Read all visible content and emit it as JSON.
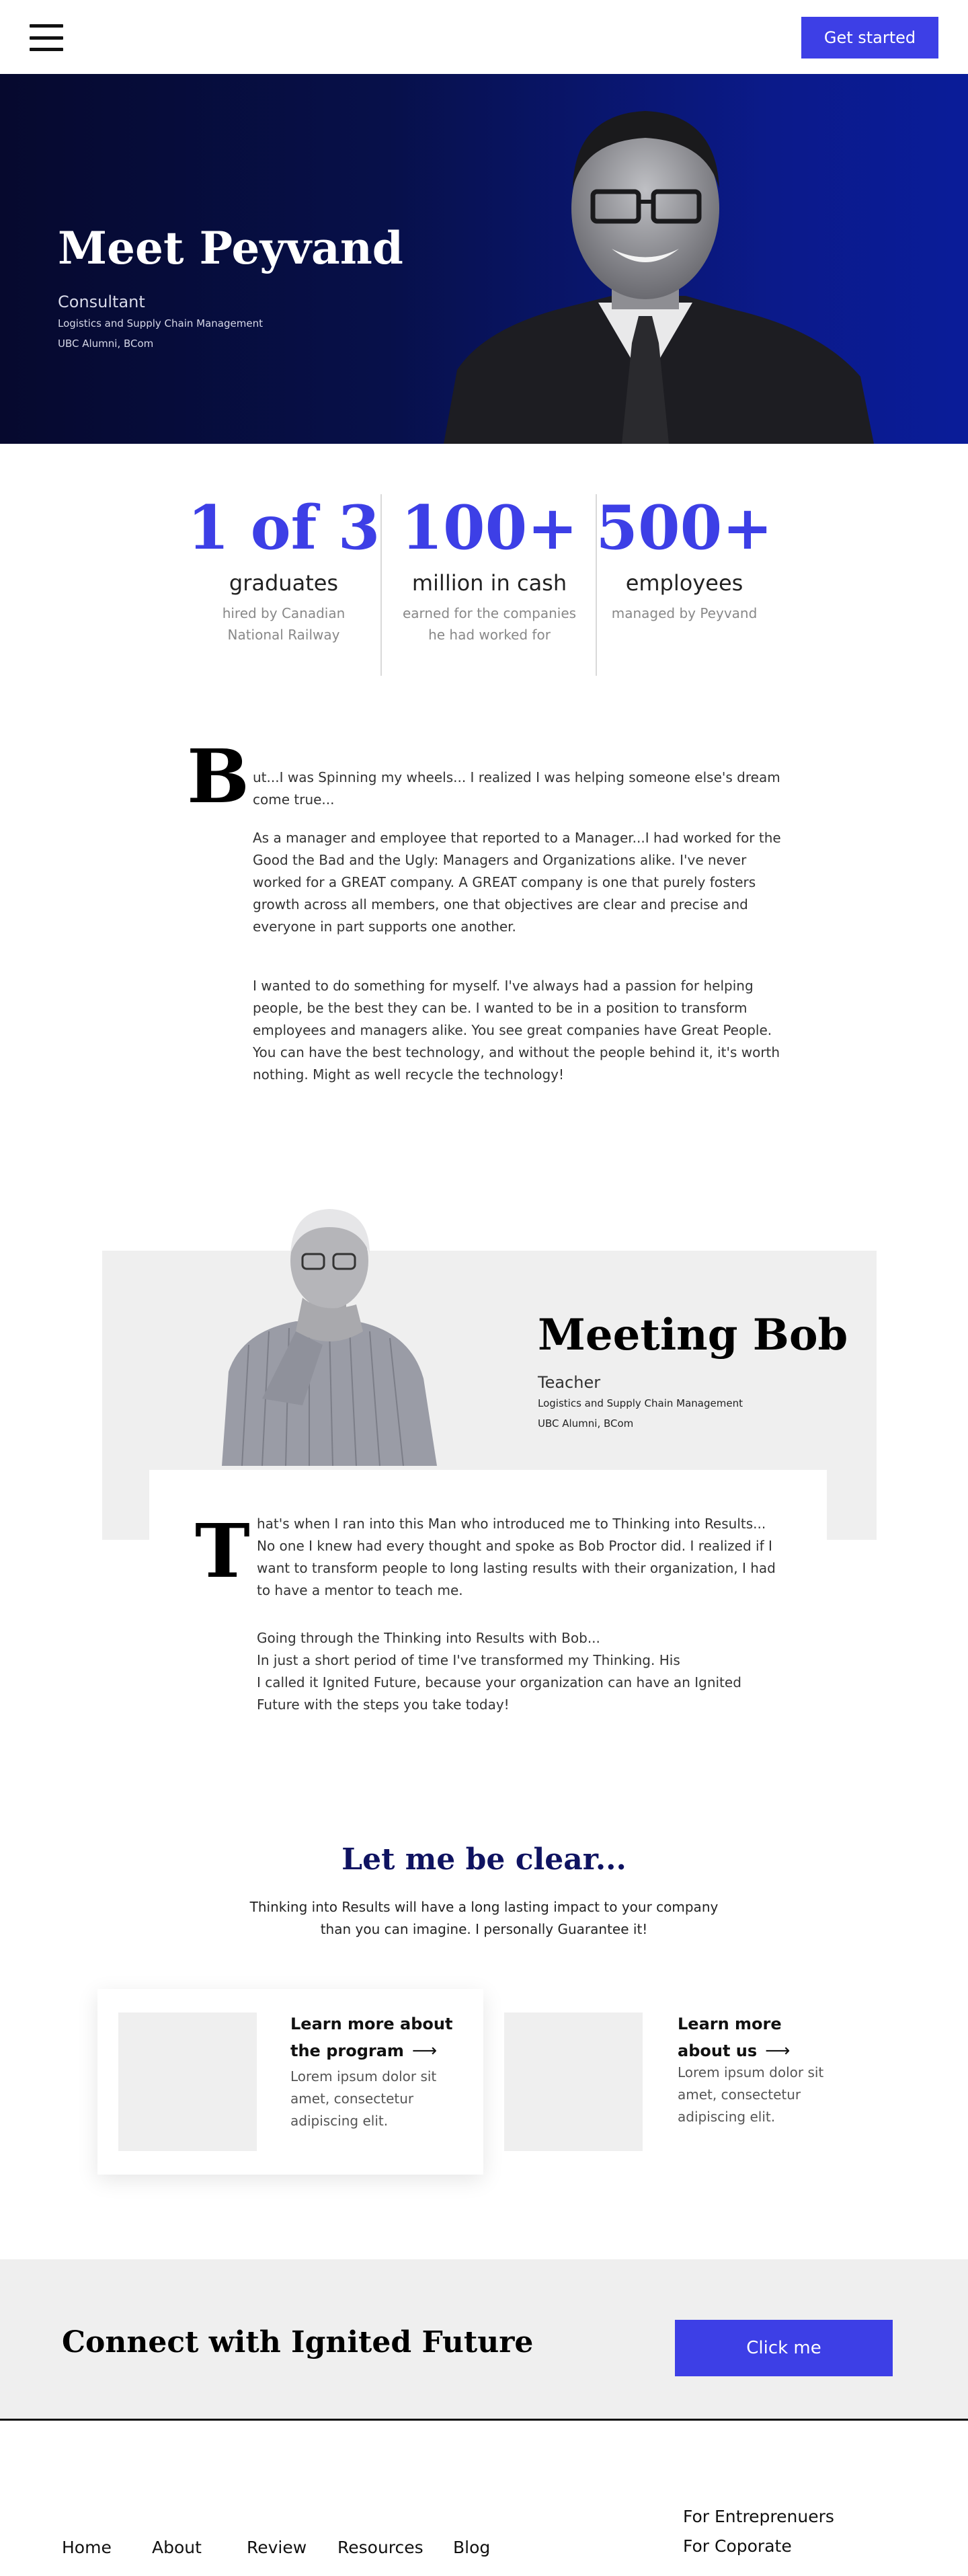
{
  "header": {
    "menu_icon": "hamburger-menu-icon",
    "cta_label": "Get started"
  },
  "hero": {
    "title": "Meet Peyvand",
    "role": "Consultant",
    "subtitle_line1": "Logistics and Supply Chain Management",
    "subtitle_line2": "UBC Alumni, BCom",
    "gradient_start": "#06092e",
    "gradient_end": "#0a1c99"
  },
  "stats": [
    {
      "number": "1 of 3",
      "label": "graduates",
      "desc_line1": "hired by Canadian",
      "desc_line2": "National Railway"
    },
    {
      "number": "100+",
      "label": "million in cash",
      "desc_line1": "earned for the companies",
      "desc_line2": "he had  worked for"
    },
    {
      "number": "500+",
      "label": "employees",
      "desc_line1": "managed by Peyvand",
      "desc_line2": ""
    }
  ],
  "story": {
    "dropcap": "B",
    "p1": "ut...I was Spinning my wheels... I realized I was helping someone else's dream come true...",
    "p2": "As a manager and employee that reported to a Manager...I had worked for the Good the Bad and the Ugly:  Managers and Organizations alike.  I've never worked for a GREAT company.  A GREAT company is one that purely fosters growth across all members, one that objectives are clear and precise and everyone in part supports one another.",
    "p3": "I wanted to do something for myself.  I've always had a passion for helping people, be the best they can be.  I wanted to be in a position to transform employees and managers alike.   You see great companies have Great People.  You can have the best technology, and without the people behind it, it's worth nothing.  Might as well recycle the technology!"
  },
  "bob": {
    "title": "Meeting Bob",
    "role": "Teacher",
    "subtitle_line1": "Logistics and Supply Chain Management",
    "subtitle_line2": "UBC Alumni, BCom",
    "dropcap": "T",
    "p1": "hat's when I ran into this Man who introduced me to Thinking into Results... No one I knew had every thought and spoke as Bob Proctor did.  I realized if I want to transform people to long lasting results with their organization, I had to have a mentor to teach me.",
    "p2_line1": "Going through the Thinking into Results with Bob...",
    "p2_line2": "In just a short period of time I've transformed my Thinking.  His",
    "p2_line3": "I called it Ignited Future, because your organization can have an Ignited Future with the steps you take today!"
  },
  "clear": {
    "title": "Let me be clear...",
    "text": "Thinking into Results will have a long lasting impact to your company than you can imagine.  I personally Guarantee it!"
  },
  "cards": [
    {
      "title": "Learn more about the program",
      "text": "Lorem ipsum dolor sit amet, consectetur adipiscing elit.",
      "arrow": "⟶"
    },
    {
      "title": "Learn more about us",
      "text": "Lorem ipsum dolor sit amet, consectetur adipiscing elit.",
      "arrow": "⟶"
    }
  ],
  "connect": {
    "title": "Connect with Ignited Future",
    "button_label": "Click me"
  },
  "footer": {
    "links": [
      "Home",
      "About",
      "Review",
      "Resources",
      "Blog"
    ],
    "right_links": [
      "For Entreprenuers",
      "For Coporate"
    ]
  },
  "colors": {
    "accent": "#3d3fe6",
    "heading_navy": "#0f1361",
    "light_gray": "#efefef"
  }
}
